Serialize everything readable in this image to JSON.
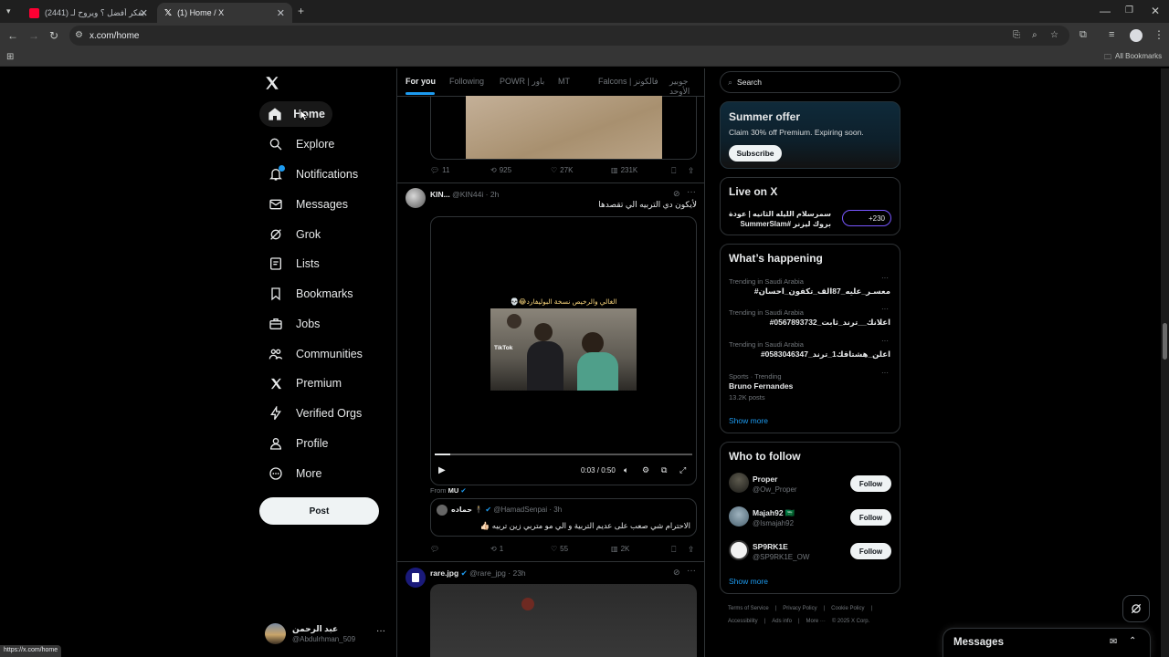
{
  "browser": {
    "tabs": [
      {
        "title": "(2441) مين بفكر أفضل ؟ ويروح لـ..."
      },
      {
        "title": "(1) Home / X"
      }
    ],
    "url": "x.com/home",
    "all_bookmarks": "All Bookmarks",
    "status_url": "https://x.com/home"
  },
  "nav": {
    "items": [
      {
        "label": "Home",
        "icon": "home-icon"
      },
      {
        "label": "Explore",
        "icon": "search-icon"
      },
      {
        "label": "Notifications",
        "icon": "bell-icon"
      },
      {
        "label": "Messages",
        "icon": "mail-icon"
      },
      {
        "label": "Grok",
        "icon": "grok-icon"
      },
      {
        "label": "Lists",
        "icon": "list-icon"
      },
      {
        "label": "Bookmarks",
        "icon": "bookmark-icon"
      },
      {
        "label": "Jobs",
        "icon": "briefcase-icon"
      },
      {
        "label": "Communities",
        "icon": "people-icon"
      },
      {
        "label": "Premium",
        "icon": "x-logo-icon"
      },
      {
        "label": "Verified Orgs",
        "icon": "lightning-icon"
      },
      {
        "label": "Profile",
        "icon": "person-icon"
      },
      {
        "label": "More",
        "icon": "more-circle-icon"
      }
    ],
    "post_label": "Post",
    "account": {
      "name": "عبد الرحمن",
      "handle": "@Abdulrhman_509"
    }
  },
  "feed": {
    "tabs": [
      "For you",
      "Following",
      "POWR | باور",
      "MT",
      "Falcons | فالكونز",
      "جوبير الأوحد"
    ],
    "post1_actions": {
      "replies": "11",
      "reposts": "925",
      "likes": "27K",
      "views": "231K"
    },
    "post2": {
      "name": "KIN...",
      "handle": "@KIN44i",
      "time": "2h",
      "text": "لأيكون دي التربيه الي تقصدها",
      "video_caption": "الغالي والرخيص نسخة البوليفارد😂💀",
      "tiktok_label": "TikTok",
      "video_time": "0:03 / 0:50",
      "video_progress": 0.06,
      "from_label": "From",
      "from_name": "MU",
      "quote": {
        "name": "حماده",
        "handle": "@HamadSenpai",
        "time": "3h",
        "text": "الاحترام شي صعب على عديم التربية و الي مو متربي زين تربيه 👍🏻"
      },
      "actions": {
        "replies": "",
        "reposts": "1",
        "likes": "55",
        "views": "2K"
      }
    },
    "post3": {
      "name": "rare.jpg",
      "handle": "@rare_jpg",
      "time": "23h"
    }
  },
  "sidebar": {
    "search_placeholder": "Search",
    "summer": {
      "title": "Summer offer",
      "text": "Claim 30% off Premium. Expiring soon.",
      "button": "Subscribe"
    },
    "live": {
      "title": "Live on X",
      "text_line1": "سمرسلام الليله الثانيه | عودة",
      "text_line2": "بروك ليزنر #SummerSlam",
      "count": "+230"
    },
    "happening": {
      "title": "What’s happening",
      "trends": [
        {
          "meta": "Trending in Saudi Arabia",
          "name": "#معسـر_عليه_87الف_تكفون_احسان"
        },
        {
          "meta": "Trending in Saudi Arabia",
          "name": "#اعلانك__ترند_ثابت_0567893732"
        },
        {
          "meta": "Trending in Saudi Arabia",
          "name": "#اعلن_هشتاقك1_ترند_0583046347"
        },
        {
          "meta": "Sports · Trending",
          "name": "Bruno Fernandes",
          "posts": "13.2K posts"
        }
      ],
      "show_more": "Show more"
    },
    "who_to_follow": {
      "title": "Who to follow",
      "users": [
        {
          "name": "Proper",
          "handle": "@Ow_Proper"
        },
        {
          "name": "Majah92 🇸🇦",
          "handle": "@Ismajah92"
        },
        {
          "name": "SP9RK1E",
          "handle": "@SP9RK1E_OW"
        }
      ],
      "follow_label": "Follow",
      "show_more": "Show more"
    },
    "footer": {
      "links": [
        "Terms of Service",
        "|",
        "Privacy Policy",
        "|",
        "Cookie Policy",
        "|"
      ],
      "links2": [
        "Accessibility",
        "|",
        "Ads info",
        "|",
        "More ···",
        "© 2025 X Corp."
      ]
    }
  },
  "messages_drawer": {
    "title": "Messages"
  },
  "colors": {
    "accent": "#1d9bf0",
    "border": "#2f3336",
    "muted": "#71767b"
  }
}
